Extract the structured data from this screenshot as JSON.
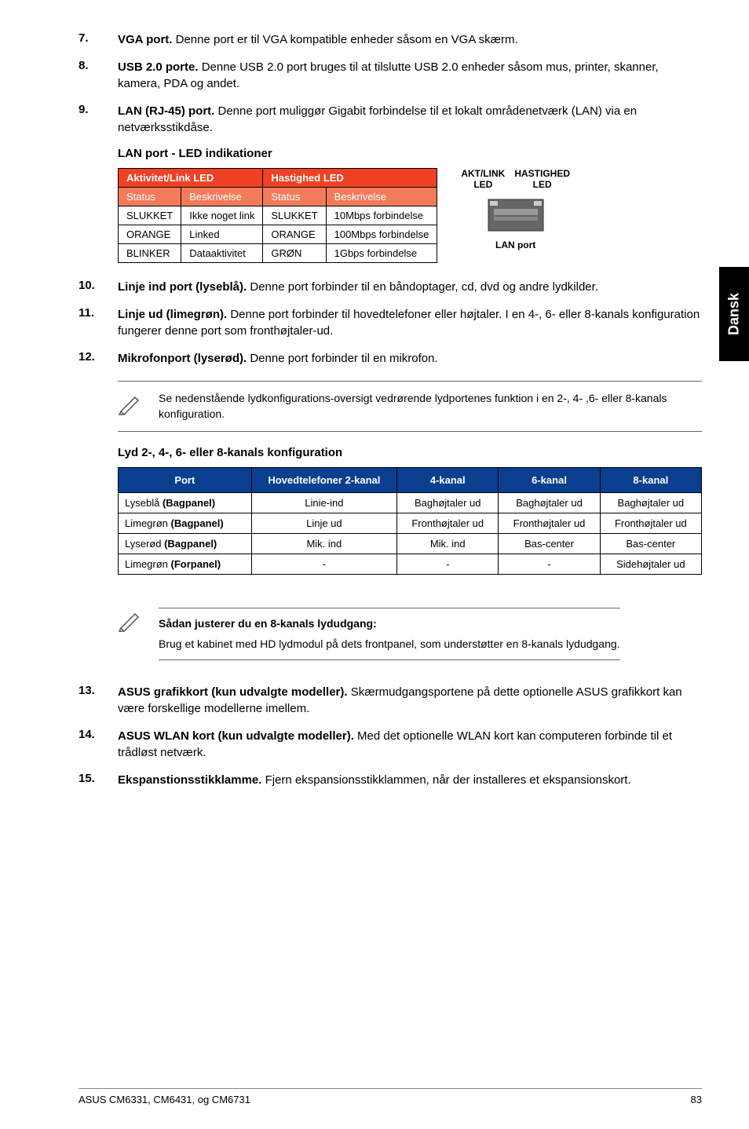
{
  "sideTab": "Dansk",
  "items": {
    "7": {
      "title": "VGA port.",
      "text": " Denne port er til VGA kompatible enheder såsom en VGA skærm."
    },
    "8": {
      "title": "USB 2.0 porte.",
      "text": " Denne USB 2.0 port bruges til at tilslutte USB 2.0 enheder såsom mus, printer, skanner, kamera, PDA og andet."
    },
    "9": {
      "title": "LAN (RJ-45) port.",
      "text": " Denne port muliggør Gigabit forbindelse til et lokalt områdenetværk (LAN) via en netværksstikdåse."
    },
    "10": {
      "title": "Linje ind port (lyseblå).",
      "text": " Denne port forbinder til en båndoptager, cd, dvd og andre lydkilder."
    },
    "11": {
      "title": "Linje ud (limegrøn).",
      "text": " Denne port forbinder til hovedtelefoner eller højtaler. I en 4-, 6- eller 8-kanals konfiguration fungerer denne port som fronthøjtaler-ud."
    },
    "12": {
      "title": "Mikrofonport (lyserød).",
      "text": " Denne port forbinder til en mikrofon."
    },
    "13": {
      "title": "ASUS grafikkort (kun udvalgte modeller).",
      "text": " Skærmudgangsportene på dette optionelle ASUS grafikkort kan være forskellige modellerne imellem."
    },
    "14": {
      "title": "ASUS WLAN kort (kun udvalgte modeller).",
      "text": " Med det optionelle WLAN kort kan computeren forbinde til et trådløst netværk."
    },
    "15": {
      "title": "Ekspanstionsstikklamme.",
      "text": " Fjern ekspansionsstikklammen, når der installeres et ekspansionskort."
    }
  },
  "ledHeading": "LAN port - LED indikationer",
  "ledTable": {
    "grp1": "Aktivitet/Link LED",
    "grp2": "Hastighed LED",
    "h1": "Status",
    "h2": "Beskrivelse",
    "h3": "Status",
    "h4": "Beskrivelse",
    "r1c1": "SLUKKET",
    "r1c2": "Ikke noget link",
    "r1c3": "SLUKKET",
    "r1c4": "10Mbps forbindelse",
    "r2c1": "ORANGE",
    "r2c2": "Linked",
    "r2c3": "ORANGE",
    "r2c4": "100Mbps forbindelse",
    "r3c1": "BLINKER",
    "r3c2": "Dataaktivitet",
    "r3c3": "GRØN",
    "r3c4": "1Gbps forbindelse"
  },
  "lanDiagram": {
    "l1": "AKT/LINK",
    "l2": "HASTIGHED",
    "led": "LED",
    "port": "LAN port"
  },
  "note1": "Se nedenstående lydkonfigurations-oversigt vedrørende lydportenes funktion i en 2-, 4- ,6- eller 8-kanals konfiguration.",
  "audioHeading": "Lyd 2-, 4-, 6- eller 8-kanals konfiguration",
  "audioTable": {
    "h1": "Port",
    "h2": "Hovedtelefoner 2-kanal",
    "h3": "4-kanal",
    "h4": "6-kanal",
    "h5": "8-kanal",
    "r1": {
      "c1a": "Lyseblå ",
      "c1b": "(Bagpanel)",
      "c2": "Linie-ind",
      "c3": "Baghøjtaler ud",
      "c4": "Baghøjtaler ud",
      "c5": "Baghøjtaler ud"
    },
    "r2": {
      "c1a": "Limegrøn ",
      "c1b": "(Bagpanel)",
      "c2": "Linje ud",
      "c3": "Fronthøjtaler ud",
      "c4": "Fronthøjtaler ud",
      "c5": "Fronthøjtaler ud"
    },
    "r3": {
      "c1a": "Lyserød ",
      "c1b": "(Bagpanel)",
      "c2": "Mik. ind",
      "c3": "Mik. ind",
      "c4": "Bas-center",
      "c5": "Bas-center"
    },
    "r4": {
      "c1a": "Limegrøn ",
      "c1b": "(Forpanel)",
      "c2": "-",
      "c3": "-",
      "c4": "-",
      "c5": "Sidehøjtaler ud"
    }
  },
  "note2": {
    "title": "Sådan justerer du en 8-kanals lydudgang:",
    "text": "Brug et kabinet med HD lydmodul på dets frontpanel, som understøtter en 8-kanals lydudgang."
  },
  "footer": {
    "left": "ASUS CM6331, CM6431, og CM6731",
    "right": "83"
  }
}
